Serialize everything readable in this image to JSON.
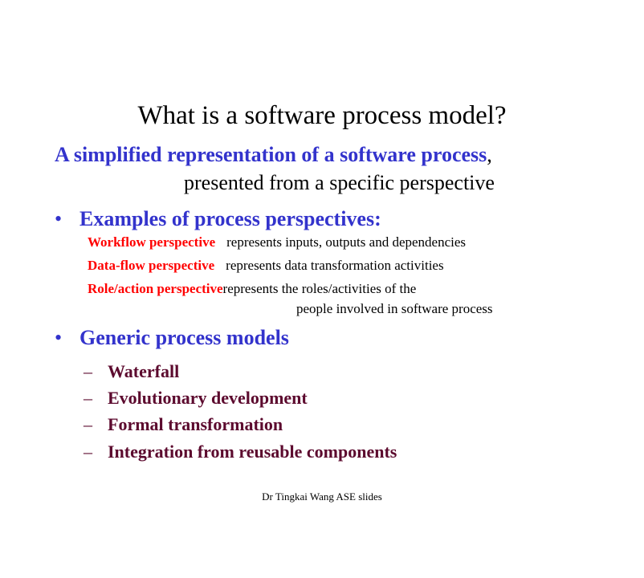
{
  "slide": {
    "title": "What is a software process model?",
    "definition": {
      "emphasis": "A simplified representation of a software process",
      "comma": ",",
      "continuation": "presented from a specific perspective"
    },
    "bullet_symbol": "•",
    "dash_symbol": "–",
    "examples": {
      "heading": "Examples of process perspectives:",
      "items": [
        {
          "name": "Workflow perspective",
          "description": "represents inputs, outputs and dependencies"
        },
        {
          "name": "Data-flow perspective",
          "description": "represents data transformation activities"
        },
        {
          "name": "Role/action perspective",
          "description": "represents the roles/activities of the",
          "description_cont": "people involved in software process"
        }
      ]
    },
    "generic": {
      "heading": "Generic process models",
      "items": [
        "Waterfall",
        "Evolutionary development",
        "Formal transformation",
        "Integration from reusable components"
      ]
    },
    "footer": "Dr Tingkai  Wang ASE slides"
  },
  "colors": {
    "accent_blue": "#3333cc",
    "perspective_red": "#ff0000",
    "subitem_maroon": "#5c0a2e"
  }
}
